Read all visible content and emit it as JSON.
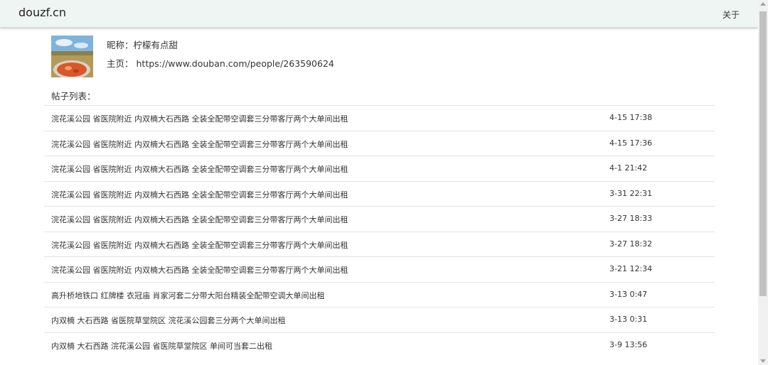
{
  "navbar": {
    "brand": "douzf.cn",
    "about": "关于"
  },
  "profile": {
    "nickname_label": "昵称：",
    "nickname": "柠檬有点甜",
    "home_label": "主页：",
    "home_url": "https://www.douban.com/people/263590624"
  },
  "list_title": "帖子列表：",
  "posts": [
    {
      "title": "浣花溪公园 省医院附近 内双楠大石西路 全装全配带空调套三分带客厅两个大单间出租",
      "time": "4-15 17:38"
    },
    {
      "title": "浣花溪公园 省医院附近 内双楠大石西路 全装全配带空调套三分带客厅两个大单间出租",
      "time": "4-15 17:36"
    },
    {
      "title": "浣花溪公园 省医院附近 内双楠大石西路 全装全配带空调套三分带客厅两个大单间出租",
      "time": "4-1 21:42"
    },
    {
      "title": "浣花溪公园 省医院附近 内双楠大石西路 全装全配带空调套三分带客厅两个大单间出租",
      "time": "3-31 22:31"
    },
    {
      "title": "浣花溪公园 省医院附近 内双楠大石西路 全装全配带空调套三分带客厅两个大单间出租",
      "time": "3-27 18:33"
    },
    {
      "title": "浣花溪公园 省医院附近 内双楠大石西路 全装全配带空调套三分带客厅两个大单间出租",
      "time": "3-27 18:32"
    },
    {
      "title": "浣花溪公园 省医院附近 内双楠大石西路 全装全配带空调套三分带客厅两个大单间出租",
      "time": "3-21 12:34"
    },
    {
      "title": "高升桥地铁口 红牌楼 衣冠庙 肖家河套二分带大阳台精装全配带空调大单间出租",
      "time": "3-13 0:47"
    },
    {
      "title": "内双楠 大石西路 省医院草堂院区 浣花溪公园套三分两个大单间出租",
      "time": "3-13 0:31"
    },
    {
      "title": "内双楠 大石西路 浣花溪公园 省医院草堂院区 单间可当套二出租",
      "time": "3-9 13:56"
    }
  ]
}
